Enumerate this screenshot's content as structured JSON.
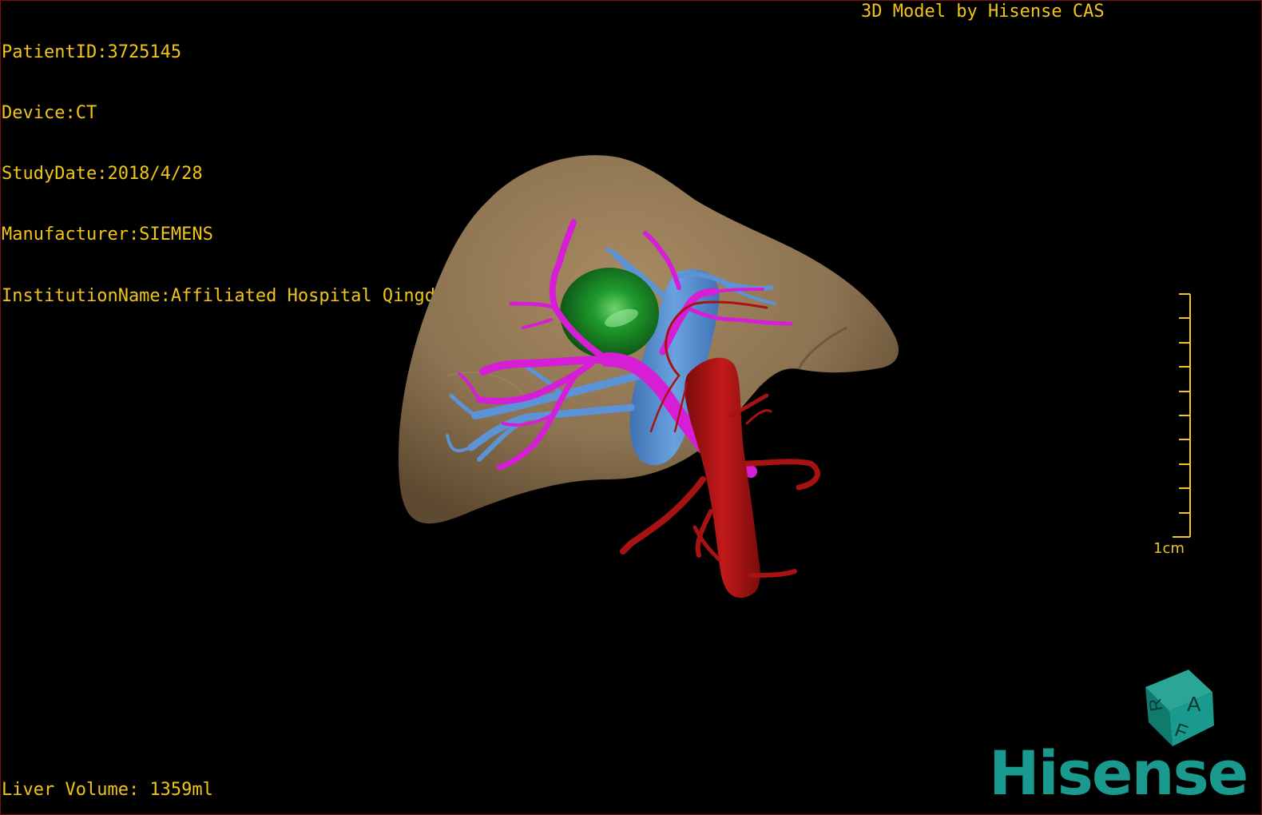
{
  "overlay": {
    "patient_id": "PatientID:3725145",
    "device": "Device:CT",
    "study_date": "StudyDate:2018/4/28",
    "manufacturer": "Manufacturer:SIEMENS",
    "institution": "InstitutionName:Affiliated Hospital Qingdao University-C",
    "credit": "3D Model by Hisense CAS",
    "liver_volume": "Liver Volume: 1359ml"
  },
  "scale_bar": {
    "label": "1cm"
  },
  "orientation_cube": {
    "faces": [
      "A",
      "R",
      "F"
    ]
  },
  "brand": {
    "name": "Hisense"
  },
  "colors": {
    "overlay_text": "#f0c419",
    "liver": "#8c7351",
    "tumor": "#1e8f2a",
    "portal_vein": "#d61ed6",
    "hepatic_vein": "#5b93d6",
    "artery": "#a81212",
    "brand": "#1a9a8e"
  }
}
